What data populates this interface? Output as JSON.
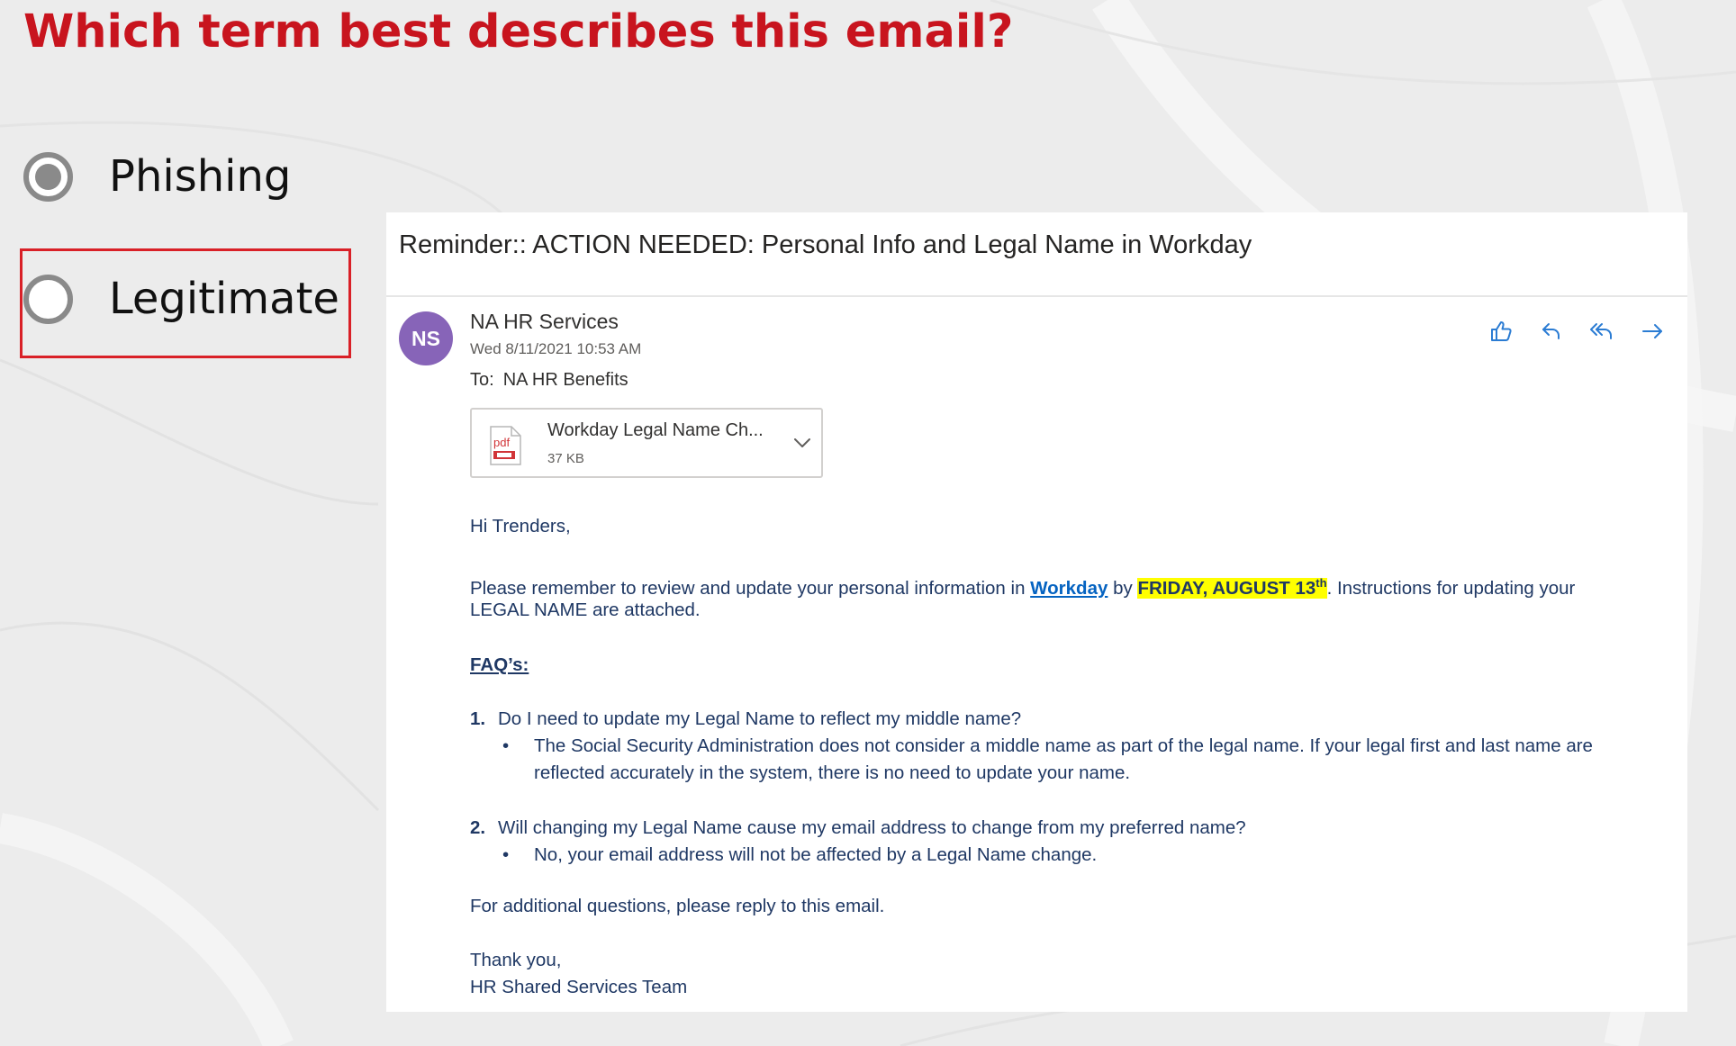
{
  "question": "Which term best describes this email?",
  "options": [
    {
      "label": "Phishing",
      "selected": true
    },
    {
      "label": "Legitimate",
      "selected": false
    }
  ],
  "colors": {
    "question": "#c8141e",
    "focus_box": "#d92027",
    "avatar": "#8764b8",
    "link": "#0563c1",
    "highlight": "#ffff00",
    "action_icons": "#2b7cd3"
  },
  "email": {
    "subject": "Reminder:: ACTION NEEDED: Personal Info and Legal Name in Workday",
    "avatar_initials": "NS",
    "sender": "NA HR Services",
    "date": "Wed 8/11/2021 10:53 AM",
    "to_label": "To:",
    "to": "NA HR Benefits",
    "actions": [
      "like-icon",
      "reply-icon",
      "reply-all-icon",
      "forward-icon"
    ],
    "attachment": {
      "name": "Workday Legal Name Ch...",
      "size": "37 KB",
      "type": "pdf"
    },
    "greeting": "Hi Trenders,",
    "para1_before": "Please remember to review and update your personal information in ",
    "para1_link": "Workday",
    "para1_by": " by ",
    "para1_deadline": "FRIDAY, AUGUST 13",
    "para1_deadline_sup": "th",
    "para1_after": ". Instructions for updating your",
    "para1_line2": "LEGAL NAME are attached.",
    "faq_heading": "FAQ’s:",
    "faq": [
      {
        "num": "1.",
        "question": "Do I need to update my Legal Name to reflect my middle name?",
        "answer_line1": "The Social Security Administration does not consider a middle name as part of the legal name.  If your legal first and last name are",
        "answer_line2": "reflected accurately in the system, there is no need to update your name."
      },
      {
        "num": "2.",
        "question": "Will changing my Legal Name cause my email address to change from my preferred name?",
        "answer_line1": "No, your email address will not be affected by a Legal Name change."
      }
    ],
    "closing_note": "For additional questions, please reply to this email.",
    "signoff": "Thank you,",
    "team": "HR Shared Services Team"
  }
}
